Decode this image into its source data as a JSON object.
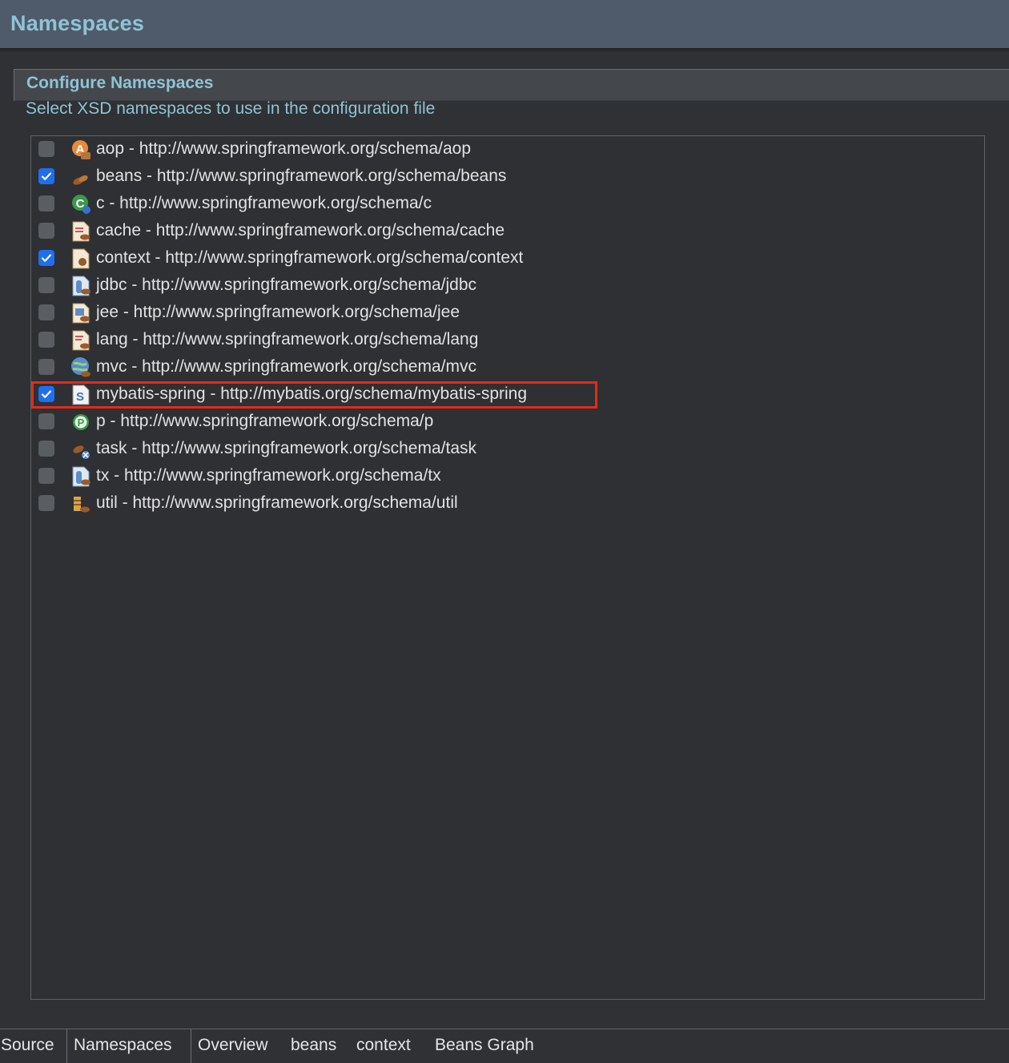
{
  "header": {
    "title": "Namespaces"
  },
  "section": {
    "title": "Configure Namespaces",
    "description": "Select XSD namespaces to use in the configuration file"
  },
  "namespaces": [
    {
      "label": "aop - http://www.springframework.org/schema/aop",
      "checked": false,
      "icon": "aop-icon"
    },
    {
      "label": "beans - http://www.springframework.org/schema/beans",
      "checked": true,
      "icon": "beans-icon"
    },
    {
      "label": "c - http://www.springframework.org/schema/c",
      "checked": false,
      "icon": "c-icon"
    },
    {
      "label": "cache - http://www.springframework.org/schema/cache",
      "checked": false,
      "icon": "cache-icon"
    },
    {
      "label": "context - http://www.springframework.org/schema/context",
      "checked": true,
      "icon": "context-icon"
    },
    {
      "label": "jdbc - http://www.springframework.org/schema/jdbc",
      "checked": false,
      "icon": "jdbc-icon"
    },
    {
      "label": "jee - http://www.springframework.org/schema/jee",
      "checked": false,
      "icon": "jee-icon"
    },
    {
      "label": "lang - http://www.springframework.org/schema/lang",
      "checked": false,
      "icon": "lang-icon"
    },
    {
      "label": "mvc - http://www.springframework.org/schema/mvc",
      "checked": false,
      "icon": "mvc-icon"
    },
    {
      "label": "mybatis-spring - http://mybatis.org/schema/mybatis-spring",
      "checked": true,
      "icon": "mybatis-spring-icon",
      "highlighted": true
    },
    {
      "label": "p - http://www.springframework.org/schema/p",
      "checked": false,
      "icon": "p-icon"
    },
    {
      "label": "task - http://www.springframework.org/schema/task",
      "checked": false,
      "icon": "task-icon"
    },
    {
      "label": "tx - http://www.springframework.org/schema/tx",
      "checked": false,
      "icon": "tx-icon"
    },
    {
      "label": "util - http://www.springframework.org/schema/util",
      "checked": false,
      "icon": "util-icon"
    }
  ],
  "tabs": [
    {
      "label": "Source",
      "active": false
    },
    {
      "label": "Namespaces",
      "active": true
    },
    {
      "label": "Overview",
      "active": false
    },
    {
      "label": "beans",
      "active": false
    },
    {
      "label": "context",
      "active": false
    },
    {
      "label": "Beans Graph",
      "active": false
    }
  ],
  "colors": {
    "accent": "#8fc3d6",
    "checkbox_checked": "#1e6ff0",
    "highlight_border": "#e32a1a"
  }
}
